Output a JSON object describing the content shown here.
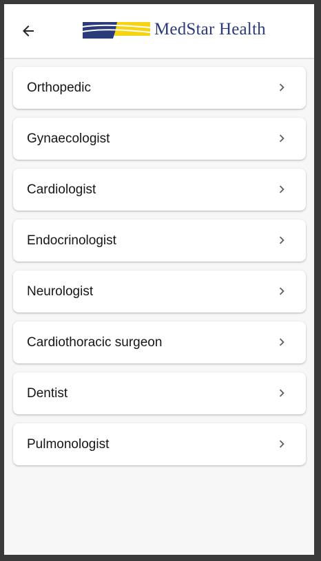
{
  "header": {
    "back_icon": "arrow-left-icon",
    "logo_text": "MedStar Health",
    "logo_colors": {
      "navy": "#2b3a78",
      "yellow": "#f6d313"
    }
  },
  "specialties": [
    {
      "label": "Orthopedic",
      "icon": "chevron-right-icon"
    },
    {
      "label": "Gynaecologist",
      "icon": "chevron-right-icon"
    },
    {
      "label": "Cardiologist",
      "icon": "chevron-right-icon"
    },
    {
      "label": "Endocrinologist",
      "icon": "chevron-right-icon"
    },
    {
      "label": "Neurologist",
      "icon": "chevron-right-icon"
    },
    {
      "label": "Cardiothoracic surgeon",
      "icon": "chevron-right-icon"
    },
    {
      "label": "Dentist",
      "icon": "chevron-right-icon"
    },
    {
      "label": "Pulmonologist",
      "icon": "chevron-right-icon"
    }
  ]
}
